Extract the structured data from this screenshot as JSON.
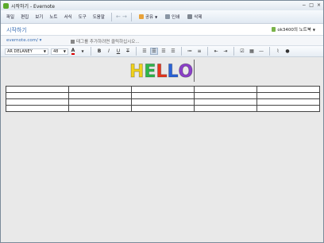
{
  "window": {
    "title": "시작하기 - Evernote",
    "controls": [
      "−",
      "□",
      "×"
    ]
  },
  "menu": [
    "파일",
    "편집",
    "보기",
    "노트",
    "서식",
    "도구",
    "도움말"
  ],
  "toolbar": {
    "back_icon": "back-arrow-icon",
    "forward_icon": "forward-arrow-icon",
    "share_label": "공유",
    "print_label": "인쇄",
    "delete_label": "삭제"
  },
  "note": {
    "title": "시작하기",
    "notebook": "ok3400의 노트북"
  },
  "tagbar": {
    "url": "evernote.com/",
    "tag_hint": "태그를 추가하려면 클릭하십시오..."
  },
  "format": {
    "font": "AR DELANEY",
    "size": "48"
  },
  "content": {
    "hello": [
      {
        "char": "H",
        "color": "#f0d21c"
      },
      {
        "char": "E",
        "color": "#2eb84a"
      },
      {
        "char": "L",
        "color": "#e8361e"
      },
      {
        "char": "L",
        "color": "#2a63d8"
      },
      {
        "char": "O",
        "color": "#8b3fc9"
      }
    ],
    "table": {
      "rows": 4,
      "cols": 5
    }
  },
  "colors": {
    "title_link": "#3a6fb5",
    "notebook_icon": "#7ab34a",
    "editor_bg": "#e9e9e9"
  }
}
